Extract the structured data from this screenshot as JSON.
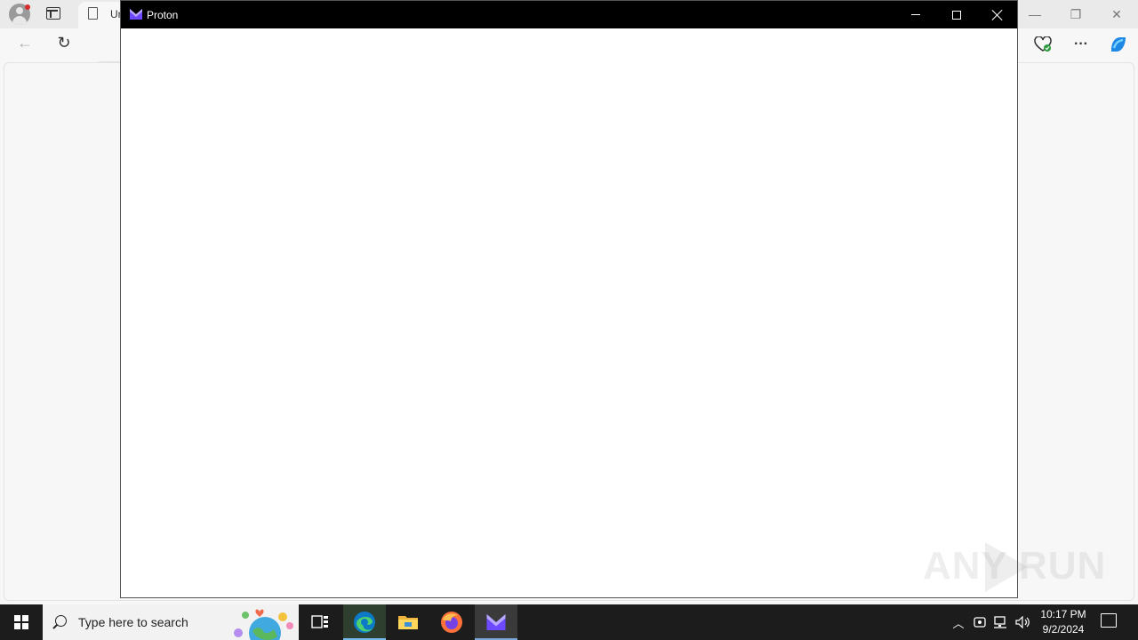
{
  "edge": {
    "tab_title": "Ur",
    "window_controls": [
      "minimize",
      "restore",
      "close"
    ]
  },
  "proton_window": {
    "title": "Proton",
    "logo_color": "#6d4aff"
  },
  "taskbar": {
    "search_placeholder": "Type here to search",
    "pinned": [
      "Task View",
      "Microsoft Edge",
      "File Explorer",
      "Firefox",
      "Proton"
    ],
    "clock": {
      "time": "10:17 PM",
      "date": "9/2/2024"
    }
  },
  "watermark": {
    "text_left": "ANY",
    "text_right": "RUN"
  }
}
